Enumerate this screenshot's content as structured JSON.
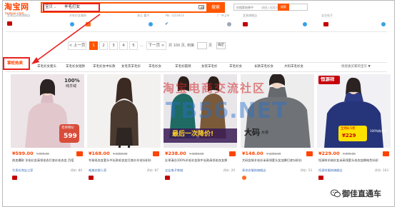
{
  "header": {
    "logo": "淘宝网",
    "logo_sub": "taobao.com",
    "search_category": "宝贝",
    "search_caret": "⌄",
    "search_value": "羊毛打女",
    "search_button": "搜索",
    "right_search_label": "在搜索结果中",
    "right_search_placeholder": "请输入搜索词",
    "right_search_button": "搜索"
  },
  "top_strip": {
    "texts": [
      "女装运动装旗舰店",
      "羊毛衫女服饰",
      "浙江 嘉兴",
      "No. 1223413",
      "广 中山市",
      "女装旗舰店",
      "宝业电子"
    ]
  },
  "pagination": {
    "prev": "< 上一页",
    "pages": [
      "1",
      "2",
      "3",
      "4",
      "5"
    ],
    "ellipsis": "...",
    "next": "下一页 >",
    "total": "共 100 页,",
    "goto": "到第",
    "page_unit": "页",
    "ok": "确定"
  },
  "hot": {
    "label": "掌柜热卖",
    "tabs": [
      "羊毛衫女套头",
      "羊毛衫女短款",
      "羊毛衫女中长款",
      "女毛衣羊毛衫",
      "羊毛衫女",
      "羊毛衫圆领",
      "女装羊毛衫",
      "羊毛衫女",
      "长款羊毛衫女",
      "大码羊毛衫女"
    ],
    "right": "找优质买家的宝贝 ▼"
  },
  "products": [
    {
      "price": "¥599.00",
      "old_price": "¥ 899.00",
      "title": "热卖爆款 羊毛衫女高领毛衣打底衫毛衣女 百搭",
      "shop": "华贵坊淘宝之家",
      "reviews": "评价: 80",
      "img_top": "100%",
      "img_top2": "纯羊绒",
      "img_badge": "年终特价",
      "img_badge2": "599"
    },
    {
      "price": "¥168.00",
      "old_price": "¥ 1280.00",
      "title": "冬装毛衣女套头中长款毛衣女打底衫羊毛针织衫",
      "shop": "唯美衣都人家",
      "reviews": "评价: 87"
    },
    {
      "price": "¥238.00",
      "old_price": "¥ 1000.00",
      "title": "反季清仓100%羊毛衫女款中长款高领毛衣女厚",
      "shop": "宝业电子商城",
      "reviews": "评价: 20",
      "img_sale": "最后一次降价!"
    },
    {
      "price": "¥148.00",
      "old_price": "¥ 1280.00",
      "title": "大码女装羊毛衫半高领套头女加厚打底针织衫",
      "shop": "易衣衣服饰旗舰店",
      "reviews": "评价: 53",
      "img_badge": "大码",
      "img_badge2": "女装"
    },
    {
      "price": "¥229.00",
      "old_price": "¥ 899.00",
      "title": "恒源祥羊绒衫女半高领套头毛衣加厚纯色针织",
      "shop": "恒源祥服饰旗舰店",
      "reviews": "评价: 163",
      "img_top": "恒源祥",
      "img_badge": "全场8.5折",
      "img_badge2": "¥229",
      "img_corner": "100%纯羊毛"
    }
  ],
  "watermark": {
    "line1": "淘宝电商交流社区",
    "line2": "TB56.NET"
  },
  "footer": {
    "wechat_text": "御佳直通车"
  },
  "colors": {
    "brand": "#ff4400",
    "search_border": "#ff5500",
    "annotation": "#e8231f",
    "link": "#3c6cb5"
  }
}
